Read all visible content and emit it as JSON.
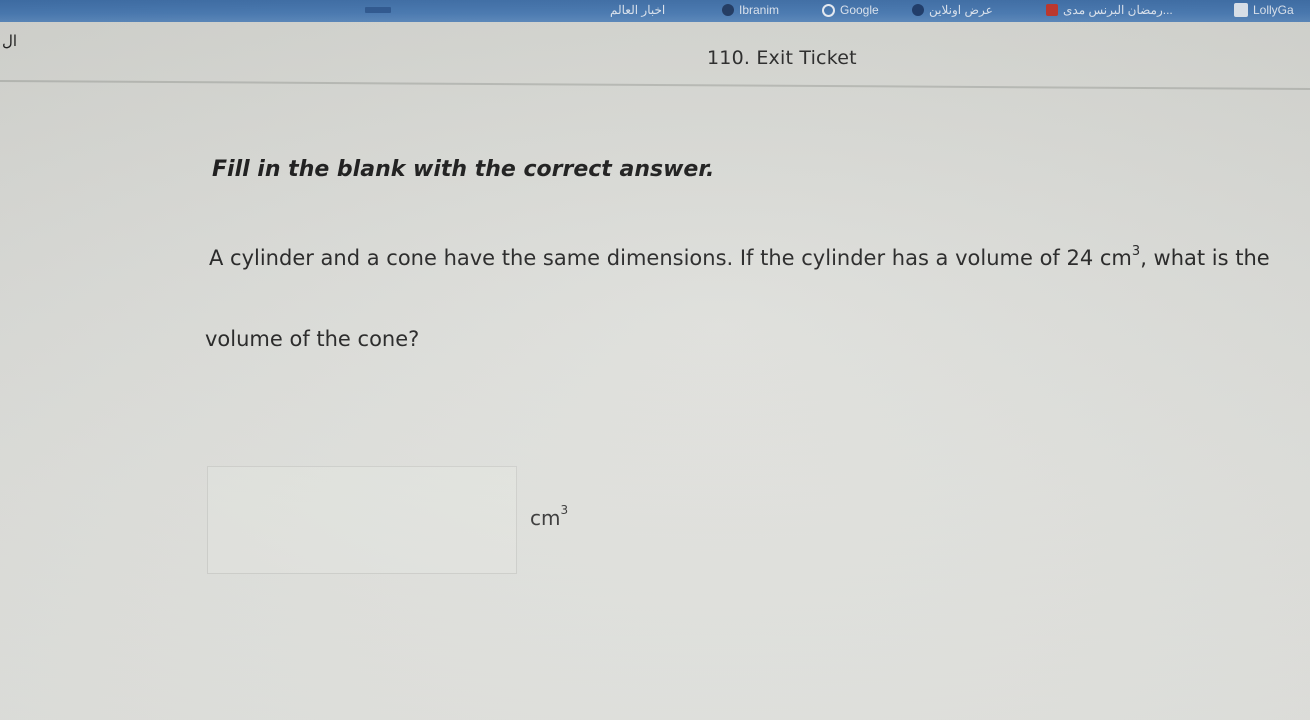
{
  "bookmarks_bar": {
    "items": [
      {
        "label": "",
        "icon": "bookmark-icon"
      },
      {
        "label": "اخبار العالم",
        "icon": "bookmark-icon"
      },
      {
        "label": "Ibranim",
        "icon": "dark-dot-icon"
      },
      {
        "label": "Google",
        "icon": "google-icon"
      },
      {
        "label": "عرض اونلاين",
        "icon": "s-logo-icon"
      },
      {
        "label": "رمضان البرنس مدى...",
        "icon": "red-bookmark-icon"
      },
      {
        "label": "LollyGa",
        "icon": "page-icon"
      }
    ]
  },
  "header": {
    "left_fragment": "ال",
    "title": "110. Exit Ticket"
  },
  "content": {
    "instruction": "Fill in the blank with the correct answer.",
    "question_line1_prefix": "A cylinder and a cone have the same dimensions. If the cylinder has a volume of 24 cm",
    "question_line1_sup": "3",
    "question_line1_suffix": ", what is the",
    "question_line2": "volume of the cone?",
    "answer": {
      "value": "",
      "placeholder": ""
    },
    "unit": "cm",
    "unit_sup": "3"
  },
  "colors": {
    "bookmarks_bar": "#4a7bb4",
    "page_background": "#dcddd9",
    "text": "#262626"
  }
}
